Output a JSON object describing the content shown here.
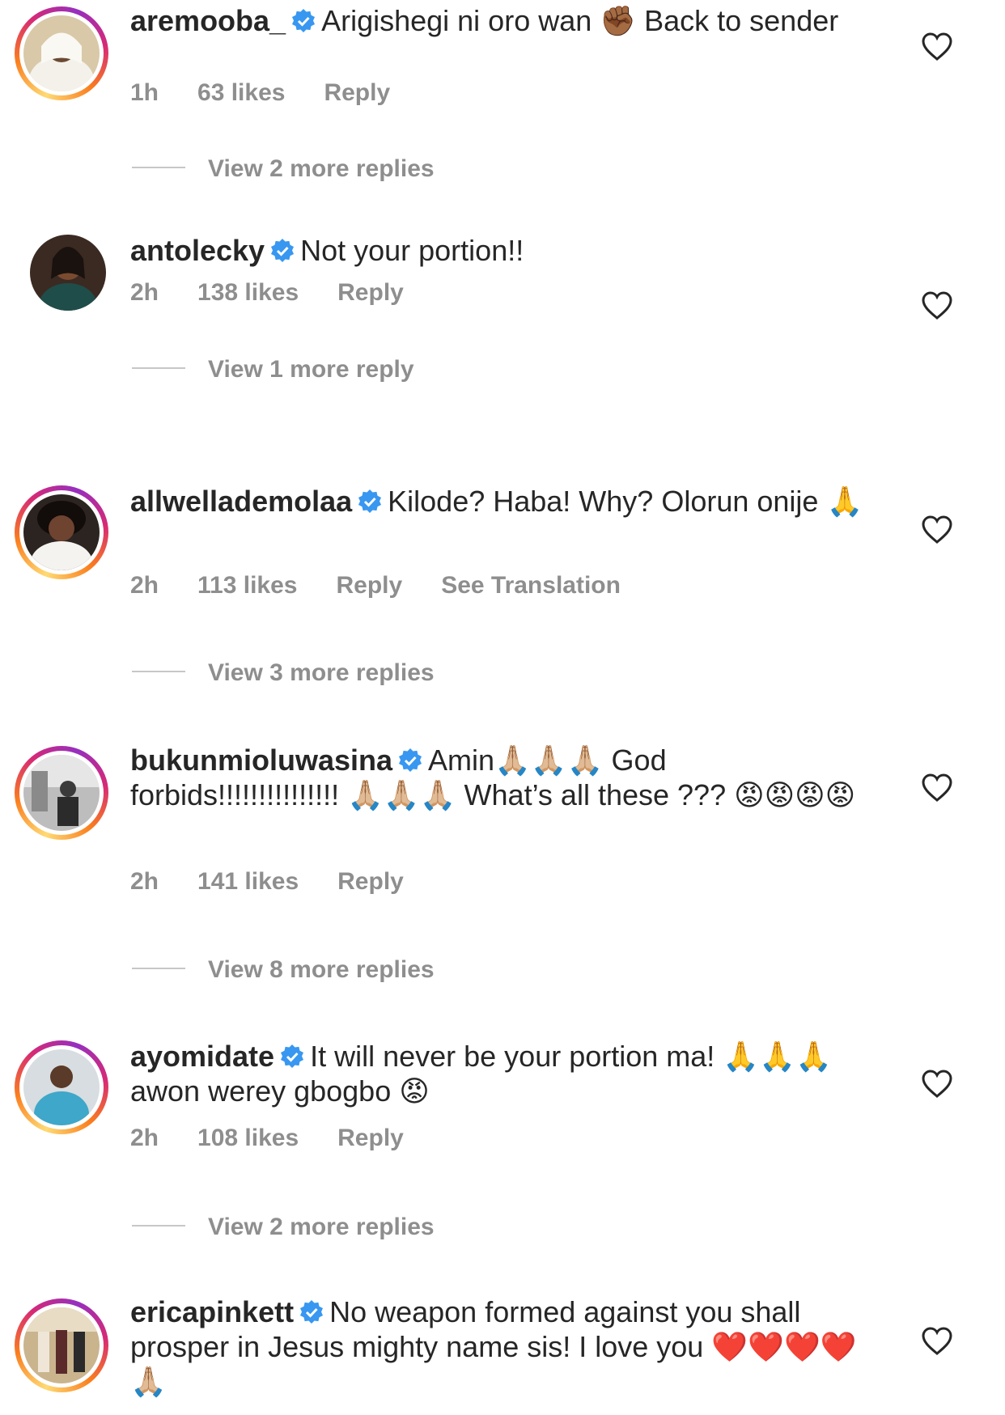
{
  "comments": [
    {
      "username": "aremooba_",
      "text": "Arigishegi ni oro wan ✊🏾 Back to sender",
      "time": "1h",
      "likes": "63 likes",
      "reply": "Reply",
      "extra": "",
      "view_replies": "View 2 more replies",
      "story_ring": true
    },
    {
      "username": "antolecky",
      "text": "Not your portion!!",
      "time": "2h",
      "likes": "138 likes",
      "reply": "Reply",
      "extra": "",
      "view_replies": "View 1 more reply",
      "story_ring": false
    },
    {
      "username": "allwellademolaa",
      "text": "Kilode? Haba! Why? Olorun onije 🙏",
      "time": "2h",
      "likes": "113 likes",
      "reply": "Reply",
      "extra": "See Translation",
      "view_replies": "View 3 more replies",
      "story_ring": true
    },
    {
      "username": "bukunmioluwasina",
      "text": "Amin🙏🏼🙏🏼🙏🏼 God forbids!!!!!!!!!!!!!!! 🙏🏼🙏🏼🙏🏼 What’s all these ??? 😡😡😡😡",
      "time": "2h",
      "likes": "141 likes",
      "reply": "Reply",
      "extra": "",
      "view_replies": "View 8 more replies",
      "story_ring": true
    },
    {
      "username": "ayomidate",
      "text": "It will never be your portion ma! 🙏🙏🙏 awon werey gbogbo 😡",
      "time": "2h",
      "likes": "108 likes",
      "reply": "Reply",
      "extra": "",
      "view_replies": "View 2 more replies",
      "story_ring": true
    },
    {
      "username": "ericapinkett",
      "text": "No weapon formed against you shall prosper in Jesus mighty name sis! I love you ❤️❤️❤️❤️🙏🏼",
      "time": "",
      "likes": "",
      "reply": "",
      "extra": "",
      "view_replies": "",
      "story_ring": true
    }
  ],
  "colors": {
    "text": "#262626",
    "meta": "#8e8e8e",
    "verified": "#3897f0",
    "ring_start": "#feda75",
    "ring_end": "#d62976"
  },
  "icons": {
    "verified": "verified-badge-icon",
    "like": "heart-outline-icon"
  }
}
